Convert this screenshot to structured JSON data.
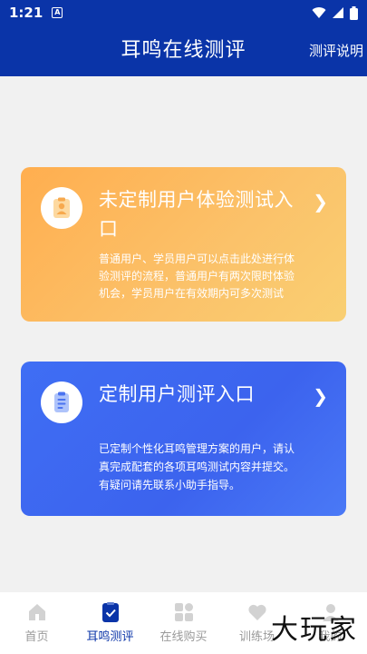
{
  "status_bar": {
    "time": "1:21",
    "notification_letter": "A"
  },
  "app_bar": {
    "title": "耳鸣在线测评",
    "help_label": "测评说明"
  },
  "cards": [
    {
      "title": "未定制用户体验测试入口",
      "description": "普通用户、学员用户可以点击此处进行体验测评的流程，普通用户有两次限时体验机会，学员用户在有效期内可多次测试",
      "icon": "id-card-icon",
      "color": "#ffae4f"
    },
    {
      "title": "定制用户测评入口",
      "description": "已定制个性化耳鸣管理方案的用户，请认真完成配套的各项耳鸣测试内容并提交。有疑问请先联系小助手指导。",
      "icon": "clipboard-icon",
      "color": "#3f6ef4"
    }
  ],
  "tabs": [
    {
      "label": "首页",
      "icon": "home-icon",
      "active": false
    },
    {
      "label": "耳鸣测评",
      "icon": "check-clipboard-icon",
      "active": true
    },
    {
      "label": "在线购买",
      "icon": "grid-icon",
      "active": false
    },
    {
      "label": "训练场",
      "icon": "heart-icon",
      "active": false
    },
    {
      "label": "我的",
      "icon": "user-icon",
      "active": false
    }
  ],
  "watermark": "大玩家",
  "colors": {
    "primary": "#0a34a8",
    "background": "#f1f1f1",
    "tab_inactive": "#9a9a9a"
  }
}
